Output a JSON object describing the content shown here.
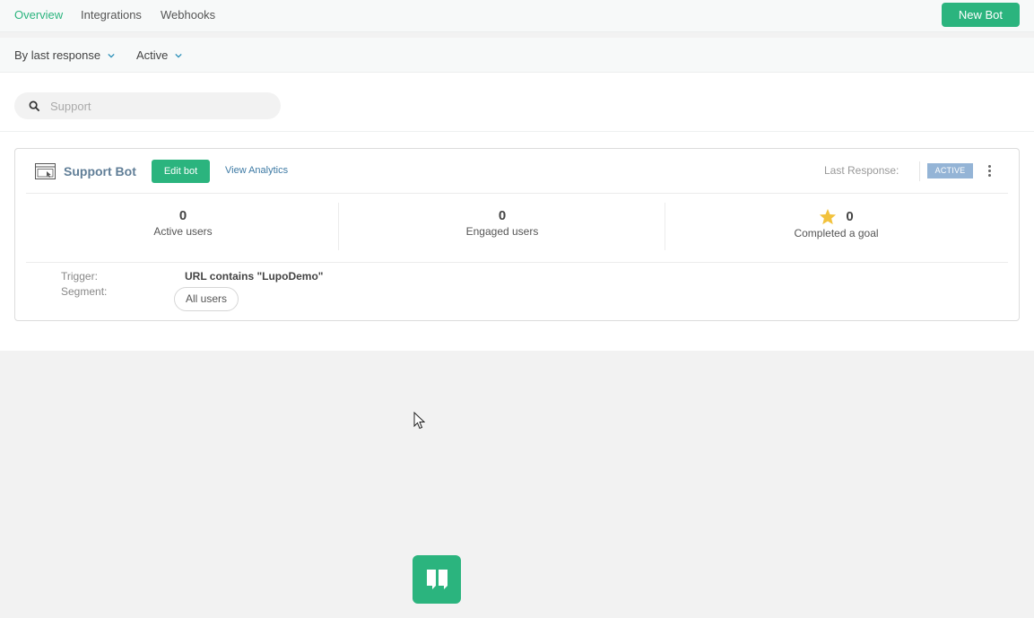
{
  "tabs": [
    {
      "label": "Overview",
      "active": true
    },
    {
      "label": "Integrations",
      "active": false
    },
    {
      "label": "Webhooks",
      "active": false
    }
  ],
  "actions": {
    "new_bot": "New Bot"
  },
  "filters": {
    "sort": "By last response",
    "status": "Active"
  },
  "search": {
    "placeholder": "Support"
  },
  "bot": {
    "name": "Support Bot",
    "edit_label": "Edit bot",
    "analytics_label": "View Analytics",
    "last_response_label": "Last Response:",
    "status_badge": "ACTIVE",
    "stats": {
      "active_users": {
        "value": "0",
        "label": "Active users"
      },
      "engaged_users": {
        "value": "0",
        "label": "Engaged users"
      },
      "completed_goal": {
        "value": "0",
        "label": "Completed a goal"
      }
    },
    "trigger_label": "Trigger:",
    "trigger_value": "URL contains \"LupoDemo\"",
    "segment_label": "Segment:",
    "segment_value": "All users"
  },
  "icons": [
    "chevron-down-icon",
    "search-icon",
    "bot-window-icon",
    "more-vertical-icon",
    "star-icon",
    "cursor-icon",
    "chat-quote-icon"
  ],
  "colors": {
    "accent": "#2bb47e",
    "link": "#3d7aa4",
    "badge": "#94b4d6",
    "star": "#f2c23d",
    "bot_name": "#607e97"
  }
}
